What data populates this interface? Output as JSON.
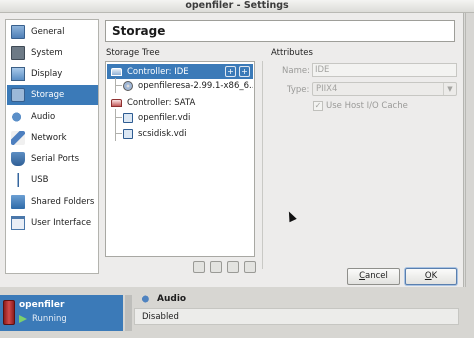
{
  "window": {
    "title": "openfiler - Settings"
  },
  "sidebar": {
    "items": [
      {
        "label": "General",
        "icon": "general-icon"
      },
      {
        "label": "System",
        "icon": "system-icon"
      },
      {
        "label": "Display",
        "icon": "display-icon"
      },
      {
        "label": "Storage",
        "icon": "storage-icon",
        "selected": true
      },
      {
        "label": "Audio",
        "icon": "audio-icon"
      },
      {
        "label": "Network",
        "icon": "network-icon"
      },
      {
        "label": "Serial Ports",
        "icon": "serial-ports-icon"
      },
      {
        "label": "USB",
        "icon": "usb-icon"
      },
      {
        "label": "Shared Folders",
        "icon": "shared-folders-icon"
      },
      {
        "label": "User Interface",
        "icon": "user-interface-icon"
      }
    ]
  },
  "page": {
    "heading": "Storage"
  },
  "storage_tree": {
    "label": "Storage Tree",
    "rows": [
      {
        "text": "Controller: IDE",
        "kind": "controller-ide",
        "selected": true
      },
      {
        "text": "openfileresa-2.99.1-x86_6...",
        "kind": "optical"
      },
      {
        "text": "Controller: SATA",
        "kind": "controller-sata"
      },
      {
        "text": "openfiler.vdi",
        "kind": "disk"
      },
      {
        "text": "scsidisk.vdi",
        "kind": "disk"
      }
    ]
  },
  "attributes": {
    "label": "Attributes",
    "name_label": "Name:",
    "name_value": "IDE",
    "type_label": "Type:",
    "type_value": "PIIX4",
    "host_io_cache_label": "Use Host I/O Cache",
    "host_io_cache_checked": true
  },
  "buttons": {
    "cancel": {
      "mnemonic": "C",
      "rest": "ancel"
    },
    "ok": {
      "mnemonic": "O",
      "rest": "K"
    }
  },
  "vm_list": {
    "name": "openfiler",
    "state": "Running"
  },
  "details": {
    "audio_title": "Audio",
    "audio_value": "Disabled"
  },
  "colors": {
    "selection": "#3b7ab8",
    "vm_icon": "#c23b3b"
  }
}
